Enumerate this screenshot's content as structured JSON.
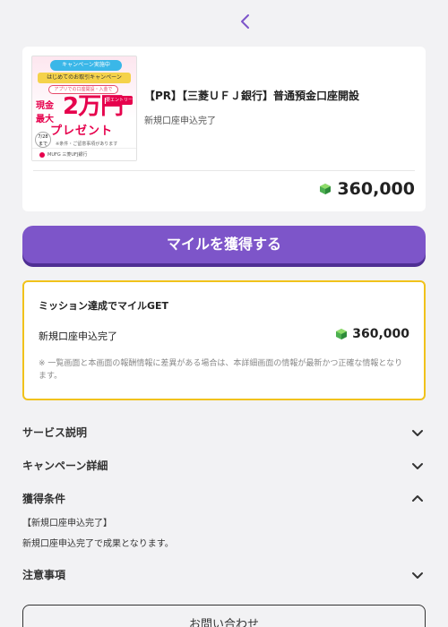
{
  "nav": {
    "back_icon": "chevron-left-icon"
  },
  "offer": {
    "title": "【PR】【三菱ＵＦＪ銀行】普通預金口座開設",
    "subtitle": "新規口座申込完了",
    "points": "360,000",
    "banner": {
      "tag_top": "キャンペーン実施中",
      "tag_mid": "はじめてのお取引キャンペーン",
      "tag_app": "アプリでの口座開設・入金で",
      "genkin": "現金最大",
      "amount": "2万円",
      "entry": "要エントリー",
      "present": "プレゼント",
      "date": "7/28まで",
      "note": "※条件・ご留意事項があります",
      "bank": "MUFG 三菱UFJ銀行"
    }
  },
  "cta": {
    "label": "マイルを獲得する"
  },
  "mission": {
    "title": "ミッション達成でマイルGET",
    "condition": "新規口座申込完了",
    "points": "360,000",
    "note": "※ 一覧画面と本画面の報酬情報に差異がある場合は、本詳細画面の情報が最新かつ正確な情報となります。"
  },
  "sections": {
    "service": "サービス説明",
    "campaign": "キャンペーン詳細",
    "conditions": "獲得条件",
    "conditions_body_1": "【新規口座申込完了】",
    "conditions_body_2": "新規口座申込完了で成果となります。",
    "notes": "注意事項"
  },
  "contact": {
    "label": "お問い合わせ"
  },
  "colors": {
    "accent": "#7d55c9",
    "mission_border": "#f1c21b",
    "gem": "#4caf50",
    "background": "#f2f2f4"
  }
}
